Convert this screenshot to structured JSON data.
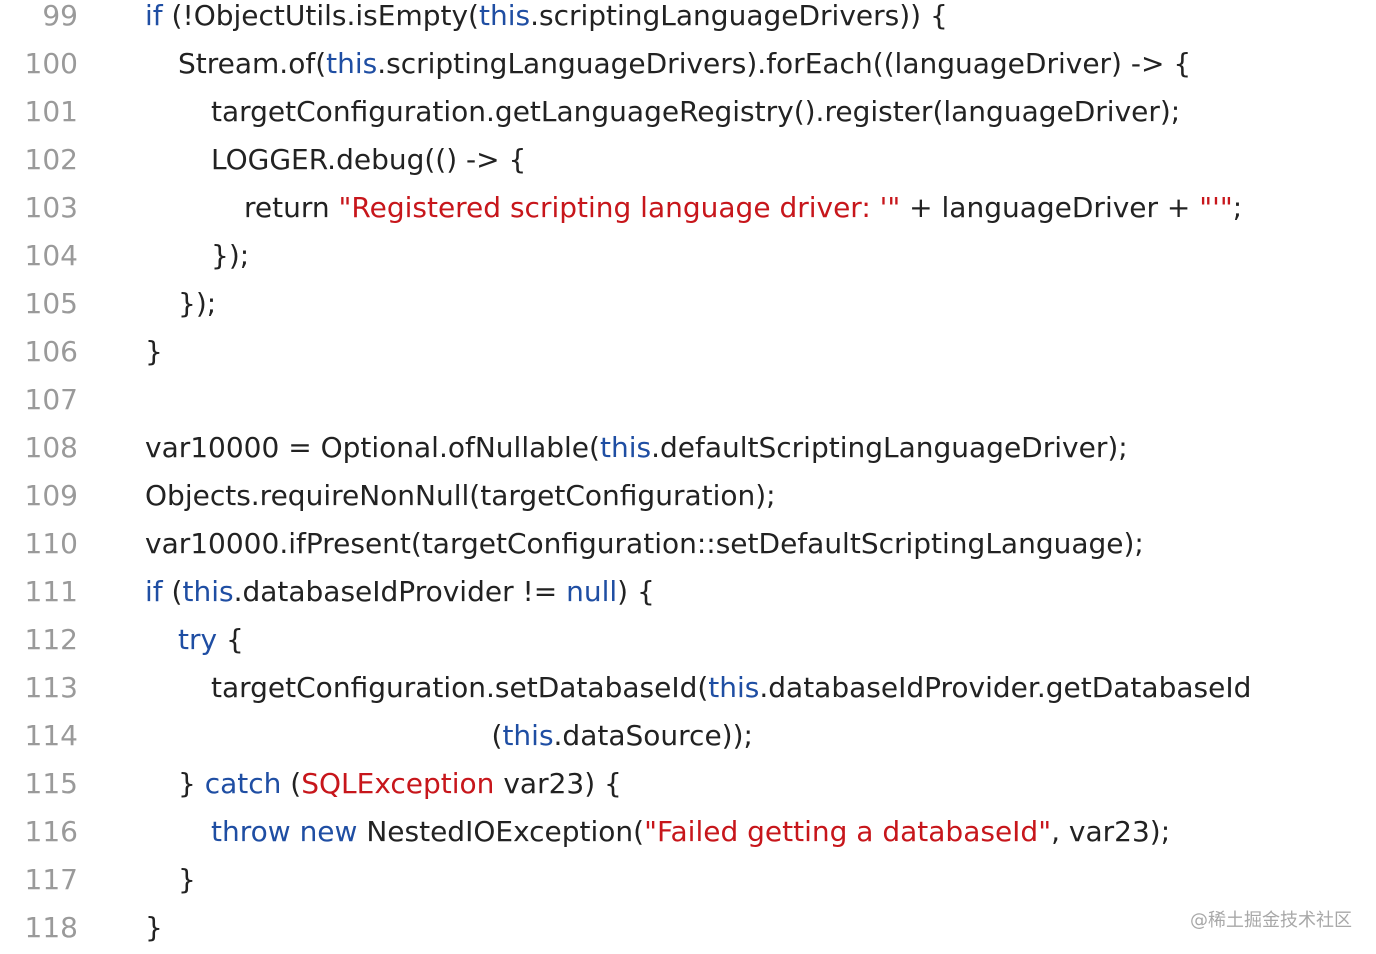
{
  "colors": {
    "keyword": "#1f4ea3",
    "string": "#c7161b",
    "text": "#222222",
    "line_number": "#9a9a9a",
    "background": "#ffffff"
  },
  "lines": [
    {
      "n": "99",
      "indent": 1,
      "parts": [
        [
          "kw",
          "if"
        ],
        [
          "plain",
          " (!ObjectUtils.isEmpty("
        ],
        [
          "kw",
          "this"
        ],
        [
          "plain",
          ".scriptingLanguageDrivers)) {"
        ]
      ]
    },
    {
      "n": "100",
      "indent": 2,
      "parts": [
        [
          "plain",
          "Stream.of("
        ],
        [
          "kw",
          "this"
        ],
        [
          "plain",
          ".scriptingLanguageDrivers).forEach((languageDriver) -> {"
        ]
      ]
    },
    {
      "n": "101",
      "indent": 3,
      "parts": [
        [
          "plain",
          "targetConfiguration.getLanguageRegistry().register(languageDriver);"
        ]
      ]
    },
    {
      "n": "102",
      "indent": 3,
      "parts": [
        [
          "plain",
          "LOGGER.debug(() -> {"
        ]
      ]
    },
    {
      "n": "103",
      "indent": 4,
      "parts": [
        [
          "plain",
          "return "
        ],
        [
          "str",
          "\"Registered scripting language driver: '\""
        ],
        [
          "plain",
          " + languageDriver + "
        ],
        [
          "str",
          "\"'\""
        ],
        [
          "plain",
          ";"
        ]
      ]
    },
    {
      "n": "104",
      "indent": 3,
      "parts": [
        [
          "plain",
          "});"
        ]
      ]
    },
    {
      "n": "105",
      "indent": 2,
      "parts": [
        [
          "plain",
          "});"
        ]
      ]
    },
    {
      "n": "106",
      "indent": 1,
      "parts": [
        [
          "plain",
          "}"
        ]
      ]
    },
    {
      "n": "107",
      "indent": 1,
      "parts": []
    },
    {
      "n": "108",
      "indent": 1,
      "parts": [
        [
          "plain",
          "var10000 = Optional.ofNullable("
        ],
        [
          "kw",
          "this"
        ],
        [
          "plain",
          ".defaultScriptingLanguageDriver);"
        ]
      ]
    },
    {
      "n": "109",
      "indent": 1,
      "parts": [
        [
          "plain",
          "Objects.requireNonNull(targetConfiguration);"
        ]
      ]
    },
    {
      "n": "110",
      "indent": 1,
      "parts": [
        [
          "plain",
          "var10000.ifPresent(targetConfiguration::setDefaultScriptingLanguage);"
        ]
      ]
    },
    {
      "n": "111",
      "indent": 1,
      "parts": [
        [
          "kw",
          "if"
        ],
        [
          "plain",
          " ("
        ],
        [
          "kw",
          "this"
        ],
        [
          "plain",
          ".databaseIdProvider != "
        ],
        [
          "kw",
          "null"
        ],
        [
          "plain",
          ") {"
        ]
      ]
    },
    {
      "n": "112",
      "indent": 2,
      "parts": [
        [
          "kw",
          "try"
        ],
        [
          "plain",
          " {"
        ]
      ]
    },
    {
      "n": "113",
      "indent": 3,
      "parts": [
        [
          "plain",
          "targetConfiguration.setDatabaseId("
        ],
        [
          "kw",
          "this"
        ],
        [
          "plain",
          ".databaseIdProvider.getDatabaseId"
        ]
      ]
    },
    {
      "n": "114",
      "indent": 11.5,
      "parts": [
        [
          "plain",
          "("
        ],
        [
          "kw",
          "this"
        ],
        [
          "plain",
          ".dataSource));"
        ]
      ]
    },
    {
      "n": "115",
      "indent": 2,
      "parts": [
        [
          "plain",
          "} "
        ],
        [
          "kw",
          "catch"
        ],
        [
          "plain",
          " ("
        ],
        [
          "cls",
          "SQLException"
        ],
        [
          "plain",
          " var23) {"
        ]
      ]
    },
    {
      "n": "116",
      "indent": 3,
      "parts": [
        [
          "kw",
          "throw"
        ],
        [
          "plain",
          " "
        ],
        [
          "kw",
          "new"
        ],
        [
          "plain",
          " NestedIOException("
        ],
        [
          "str",
          "\"Failed getting a databaseId\""
        ],
        [
          "plain",
          ", var23);"
        ]
      ]
    },
    {
      "n": "117",
      "indent": 2,
      "parts": [
        [
          "plain",
          "}"
        ]
      ]
    },
    {
      "n": "118",
      "indent": 1,
      "parts": [
        [
          "plain",
          "}"
        ]
      ]
    }
  ],
  "watermark": "@稀土掘金技术社区"
}
